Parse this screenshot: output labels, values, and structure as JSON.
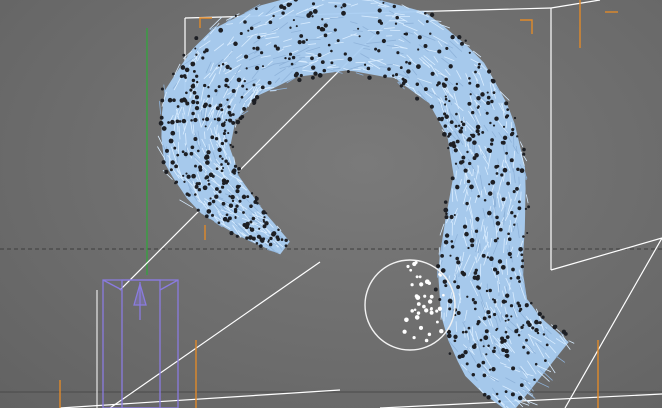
{
  "viewport": {
    "type": "3d-viewport",
    "background_color": "#6e6e6e",
    "grid_line_color": "#5c5c5c",
    "bounding_box_color": "#ffffff",
    "bounding_box_corner_color": "#e08a2a",
    "y_axis_color": "#2fa83a",
    "object": {
      "name": "fur-curl-mesh",
      "hair_color": "#a9cdf2",
      "hair_stroke_color": "#d8ecff",
      "vertex_point_color": "#1d1f24"
    },
    "light_gizmo": {
      "name": "spot-light",
      "color": "#8a7be0"
    },
    "brush_cursor": {
      "name": "hair-brush-cursor",
      "ring_color": "#f2f2f2"
    }
  }
}
